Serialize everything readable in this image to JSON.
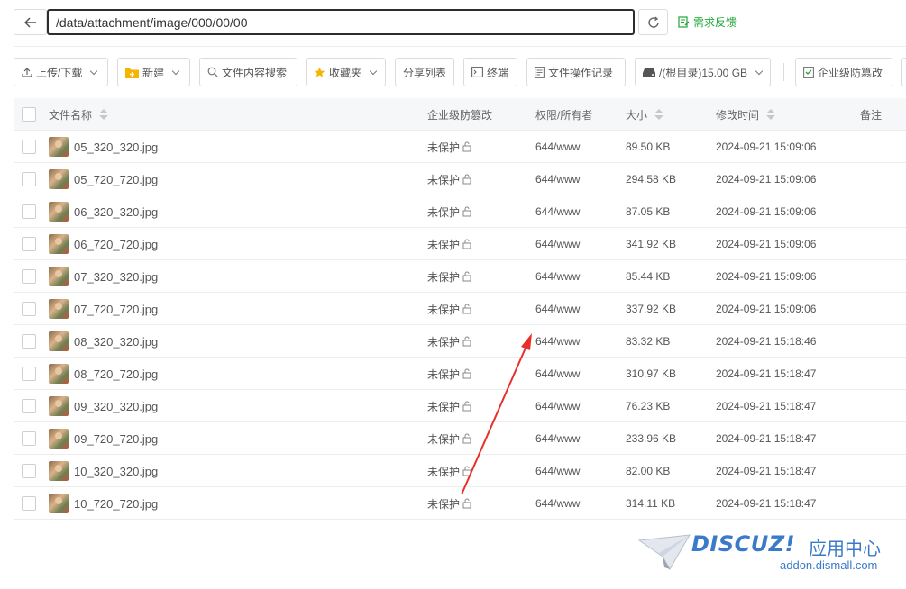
{
  "address_bar": {
    "path": "/data/attachment/image/000/00/00",
    "feedback_label": "需求反馈"
  },
  "toolbar": {
    "upload_label": "上传/下载",
    "new_label": "新建",
    "search_label": "文件内容搜索",
    "favorites_label": "收藏夹",
    "share_label": "分享列表",
    "terminal_label": "终端",
    "oplog_label": "文件操作记录",
    "disk_label": "/(根目录)15.00 GB",
    "tamper_label": "企业级防篡改"
  },
  "table": {
    "headers": {
      "name": "文件名称",
      "tamper": "企业级防篡改",
      "perm": "权限/所有者",
      "size": "大小",
      "mtime": "修改时间",
      "note": "备注"
    },
    "rows": [
      {
        "name": "05_320_320.jpg",
        "tamper": "未保护",
        "perm": "644/www",
        "size": "89.50 KB",
        "mtime": "2024-09-21 15:09:06"
      },
      {
        "name": "05_720_720.jpg",
        "tamper": "未保护",
        "perm": "644/www",
        "size": "294.58 KB",
        "mtime": "2024-09-21 15:09:06"
      },
      {
        "name": "06_320_320.jpg",
        "tamper": "未保护",
        "perm": "644/www",
        "size": "87.05 KB",
        "mtime": "2024-09-21 15:09:06"
      },
      {
        "name": "06_720_720.jpg",
        "tamper": "未保护",
        "perm": "644/www",
        "size": "341.92 KB",
        "mtime": "2024-09-21 15:09:06"
      },
      {
        "name": "07_320_320.jpg",
        "tamper": "未保护",
        "perm": "644/www",
        "size": "85.44 KB",
        "mtime": "2024-09-21 15:09:06"
      },
      {
        "name": "07_720_720.jpg",
        "tamper": "未保护",
        "perm": "644/www",
        "size": "337.92 KB",
        "mtime": "2024-09-21 15:09:06"
      },
      {
        "name": "08_320_320.jpg",
        "tamper": "未保护",
        "perm": "644/www",
        "size": "83.32 KB",
        "mtime": "2024-09-21 15:18:46"
      },
      {
        "name": "08_720_720.jpg",
        "tamper": "未保护",
        "perm": "644/www",
        "size": "310.97 KB",
        "mtime": "2024-09-21 15:18:47"
      },
      {
        "name": "09_320_320.jpg",
        "tamper": "未保护",
        "perm": "644/www",
        "size": "76.23 KB",
        "mtime": "2024-09-21 15:18:47"
      },
      {
        "name": "09_720_720.jpg",
        "tamper": "未保护",
        "perm": "644/www",
        "size": "233.96 KB",
        "mtime": "2024-09-21 15:18:47"
      },
      {
        "name": "10_320_320.jpg",
        "tamper": "未保护",
        "perm": "644/www",
        "size": "82.00 KB",
        "mtime": "2024-09-21 15:18:47"
      },
      {
        "name": "10_720_720.jpg",
        "tamper": "未保护",
        "perm": "644/www",
        "size": "314.11 KB",
        "mtime": "2024-09-21 15:18:47"
      }
    ]
  },
  "watermark": {
    "brand": "DISCUZ!",
    "brand_cn": "应用中心",
    "url": "addon.dismall.com"
  },
  "colors": {
    "accent_green": "#20a53a",
    "annotation_red": "#e8302a",
    "watermark_blue": "#3a7ac8",
    "folder_yellow": "#f5b400"
  },
  "icons": {
    "back": "arrow-left-icon",
    "refresh": "refresh-icon",
    "feedback": "edit-note-icon",
    "upload": "upload-icon",
    "new": "folder-plus-icon",
    "search": "search-icon",
    "favorites": "star-icon",
    "terminal": "terminal-icon",
    "oplog": "log-icon",
    "disk": "disk-icon",
    "tamper": "shield-doc-icon",
    "unlock": "unlock-icon"
  }
}
